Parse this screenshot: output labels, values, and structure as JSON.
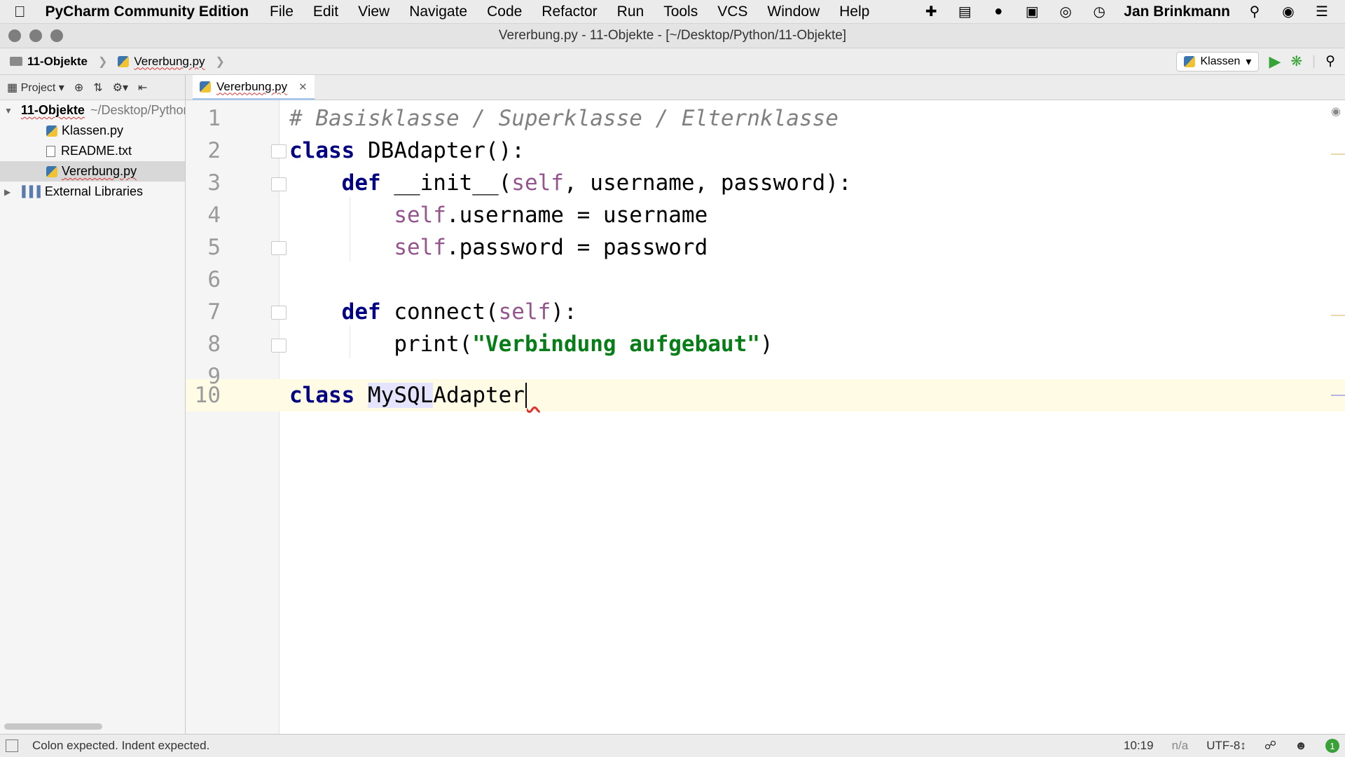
{
  "menubar": {
    "app_name": "PyCharm Community Edition",
    "menus": [
      "File",
      "Edit",
      "View",
      "Navigate",
      "Code",
      "Refactor",
      "Run",
      "Tools",
      "VCS",
      "Window",
      "Help"
    ],
    "user": "Jan Brinkmann"
  },
  "window": {
    "title": "Vererbung.py - 11-Objekte - [~/Desktop/Python/11-Objekte]"
  },
  "breadcrumb": {
    "project": "11-Objekte",
    "file": "Vererbung.py"
  },
  "run_config": {
    "name": "Klassen"
  },
  "project_panel": {
    "label": "Project",
    "root_name": "11-Objekte",
    "root_path": "~/Desktop/Python/11-Objekte",
    "files": [
      "Klassen.py",
      "README.txt",
      "Vererbung.py"
    ],
    "external_libraries": "External Libraries"
  },
  "editor": {
    "tab_label": "Vererbung.py",
    "line_numbers": [
      "1",
      "2",
      "3",
      "4",
      "5",
      "6",
      "7",
      "8",
      "9",
      "10"
    ]
  },
  "code": {
    "l1": "# Basisklasse / Superklasse / Elternklasse",
    "l2_kw": "class",
    "l2_rest": " DBAdapter():",
    "l3_kw": "def",
    "l3_name": " __init__(",
    "l3_self": "self",
    "l3_rest": ", username, password):",
    "l4_self": "self",
    "l4_rest": ".username = username",
    "l5_self": "self",
    "l5_rest": ".password = password",
    "l7_kw": "def",
    "l7_name": " connect(",
    "l7_self": "self",
    "l7_rest": "):",
    "l8_fn": "print(",
    "l8_str": "\"Verbindung aufgebaut\"",
    "l8_end": ")",
    "l10_kw": "class",
    "l10_hl": "MySQL",
    "l10_rest": "Adapter"
  },
  "statusbar": {
    "message": "Colon expected. Indent expected.",
    "position": "10:19",
    "na": "n/a",
    "encoding": "UTF-8↕",
    "badge": "1"
  }
}
